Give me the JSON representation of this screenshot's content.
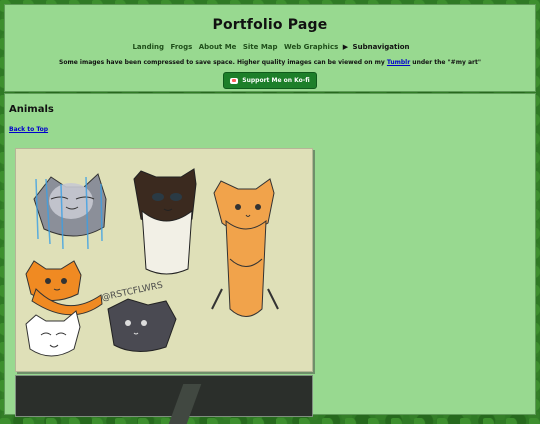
{
  "header": {
    "title": "Portfolio Page",
    "nav": [
      {
        "label": "Landing"
      },
      {
        "label": "Frogs"
      },
      {
        "label": "About Me"
      },
      {
        "label": "Site Map"
      },
      {
        "label": "Web Graphics"
      }
    ],
    "subnav_icon": "play-triangle-icon",
    "subnav_label": "Subnavigation",
    "note_prefix": "Some images have been compressed to save space. Higher quality images can be viewed on my",
    "note_link": "Tumblr",
    "note_suffix": "under the \"#my art\"",
    "kofi": {
      "icon": "coffee-cup-icon",
      "label": "Support Me on Ko-fi"
    }
  },
  "main": {
    "section_title": "Animals",
    "back_link": "Back to Top",
    "art_tag": "@RSTCFLWRS"
  },
  "colors": {
    "panel": "#98d990",
    "kofi": "#1d7f2a",
    "link": "#0000cc"
  }
}
